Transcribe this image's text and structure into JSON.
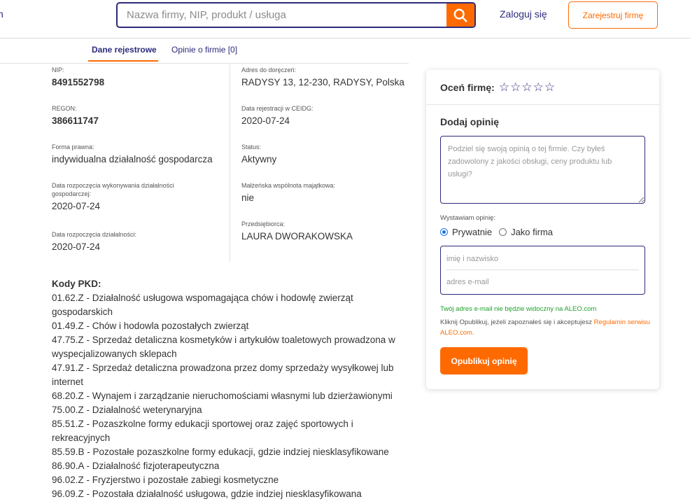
{
  "header": {
    "brand_fragment": "n",
    "search_placeholder": "Nazwa firmy, NIP, produkt / usługa",
    "login_label": "Zaloguj się",
    "register_label": "Zarejestruj firmę"
  },
  "tabs": [
    {
      "label": "Dane rejestrowe",
      "active": true
    },
    {
      "label": "Opinie o firmie [0]",
      "active": false
    }
  ],
  "fields_left": [
    {
      "label": "NIP:",
      "value": "8491552798"
    },
    {
      "label": "REGON:",
      "value": "386611747"
    },
    {
      "label": "Forma prawna:",
      "value": "indywidualna działalność gospodarcza"
    },
    {
      "label": "Data rozpoczęcia wykonywania działalności gospodarczej:",
      "value": "2020-07-24"
    },
    {
      "label": "Data rozpoczęcia działalności:",
      "value": "2020-07-24"
    }
  ],
  "fields_right": [
    {
      "label": "Adres do doręczeń:",
      "value": "RADYSY 13, 12-230, RADYSY, Polska"
    },
    {
      "label": "Data rejestracji w CEIDG:",
      "value": "2020-07-24"
    },
    {
      "label": "Status:",
      "value": "Aktywny"
    },
    {
      "label": "Małżeńska wspólnota majątkowa:",
      "value": "nie"
    },
    {
      "label": "Przedsiębiorca:",
      "value": "LAURA DWORAKOWSKA"
    }
  ],
  "pkd": {
    "title": "Kody PKD:",
    "items": [
      "01.62.Z - Działalność usługowa wspomagająca chów i hodowlę zwierząt gospodarskich",
      "01.49.Z - Chów i hodowla pozostałych zwierząt",
      "47.75.Z - Sprzedaż detaliczna kosmetyków i artykułów toaletowych prowadzona w wyspecjalizowanych sklepach",
      "47.91.Z - Sprzedaż detaliczna prowadzona przez domy sprzedaży wysyłkowej lub internet",
      "68.20.Z - Wynajem i zarządzanie nieruchomościami własnymi lub dzierżawionymi",
      "75.00.Z - Działalność weterynaryjna",
      "85.51.Z - Pozaszkolne formy edukacji sportowej oraz zajęć sportowych i rekreacyjnych",
      "85.59.B - Pozostałe pozaszkolne formy edukacji, gdzie indziej niesklasyfikowane",
      "86.90.A - Działalność fizjoterapeutyczna",
      "96.02.Z - Fryzjerstwo i pozostałe zabiegi kosmetyczne",
      "96.09.Z - Pozostała działalność usługowa, gdzie indziej niesklasyfikowana"
    ]
  },
  "review_card": {
    "rate_label": "Oceń firmę:",
    "star_count": 5,
    "star_icon": "star-outline-icon",
    "add_title": "Dodaj opinię",
    "review_placeholder": "Podziel się swoją opinią o tej firmie. Czy byłeś zadowolony z jakości obsługi, ceny produktu lub usługi?",
    "issue_label": "Wystawiam opinię:",
    "radio_private": "Prywatnie",
    "radio_company": "Jako firma",
    "selected": "Prywatnie",
    "name_placeholder": "imię i nazwisko",
    "email_placeholder": "adres e-mail",
    "email_note": "Twój adres e-mail nie będzie widoczny na ALEO.com",
    "terms_text": "Kliknij Opublikuj, jeżeli zapoznałeś się i akceptujesz ",
    "terms_link": "Regulamin serwisu ALEO.com.",
    "publish_label": "Opublikuj opinię"
  },
  "colors": {
    "accent": "#ff6a00",
    "navy": "#2c2b7c",
    "success": "#1fa02a"
  }
}
